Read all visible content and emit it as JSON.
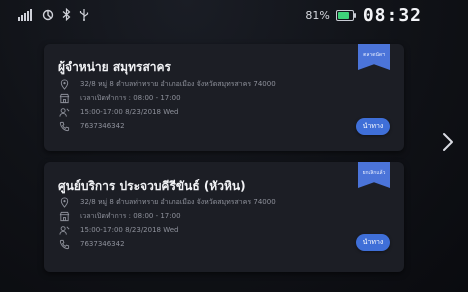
{
  "status": {
    "battery_percent": "81%",
    "battery_level": 0.81,
    "time": "08:32",
    "icons": [
      "signal-icon",
      "nfc-icon",
      "bluetooth-icon",
      "usb-icon",
      "battery-icon"
    ]
  },
  "colors": {
    "accent": "#3f6fd8",
    "ribbon": "#4b74d9",
    "card": "#1c1e25",
    "background": "#101217",
    "battery": "#3ed27a"
  },
  "cards": [
    {
      "title": "ผู้จำหน่าย สมุทรสาคร",
      "badge": "ตลาดนัดฯ",
      "address": "32/8 หมู่ 8 ตำบลท่าทราย อำเภอเมือง จังหวัดสมุทรสาคร 74000",
      "hours": "เวลาเปิดทำการ : 08:00 - 17:00",
      "schedule": "15:00-17:00 8/23/2018 Wed",
      "phone": "7637346342",
      "button": "นำทาง"
    },
    {
      "title": "ศูนย์บริการ ประจวบคีรีขันธ์ (หัวหิน)",
      "badge": "ยกเลิกแล้ว",
      "address": "32/8 หมู่ 8 ตำบลท่าทราย อำเภอเมือง จังหวัดสมุทรสาคร 74000",
      "hours": "เวลาเปิดทำการ : 08:00 - 17:00",
      "schedule": "15:00-17:00 8/23/2018 Wed",
      "phone": "7637346342",
      "button": "นำทาง"
    }
  ],
  "pager": {
    "next_icon": "chevron-right-icon"
  }
}
